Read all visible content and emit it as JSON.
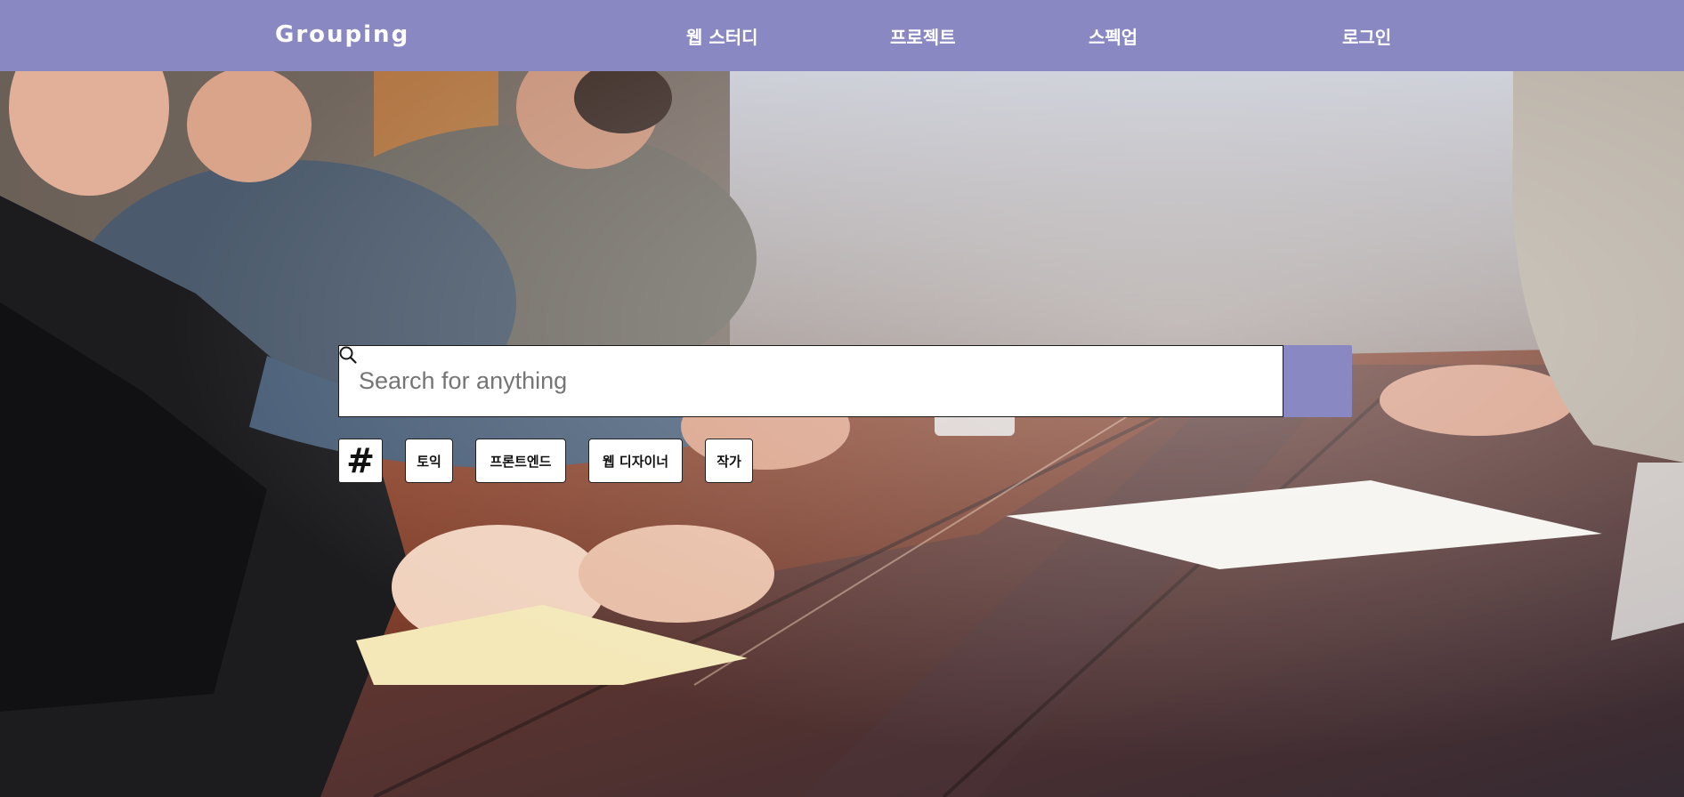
{
  "navbar": {
    "logo": "Grouping",
    "links": [
      "웹 스터디",
      "프로젝트",
      "스펙업",
      "로그인"
    ],
    "background": "#8a88c2"
  },
  "search": {
    "placeholder": "Search for anything",
    "value": "",
    "button_icon": "search-icon"
  },
  "tags": {
    "hash_symbol": "#",
    "items": [
      "토익",
      "프론트엔드",
      "웹 디자이너",
      "작가"
    ]
  },
  "hero": {
    "image": "people-writing-at-wooden-table-photo"
  },
  "colors": {
    "accent": "#8a88c2",
    "text_on_accent": "#ffffff"
  }
}
